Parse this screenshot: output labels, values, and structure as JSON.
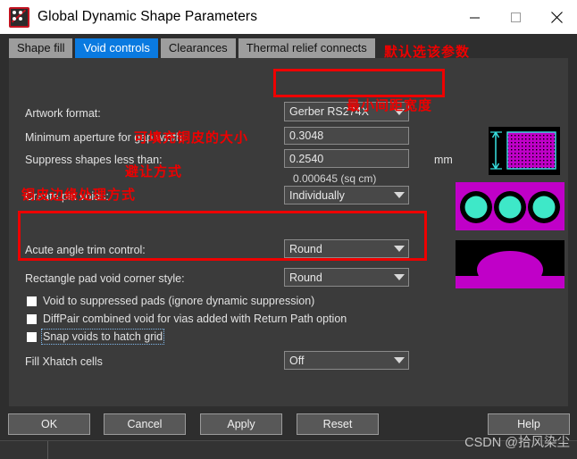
{
  "window": {
    "title": "Global Dynamic Shape Parameters",
    "icon": "allegro-app-icon",
    "minimize_label": "−",
    "maximize_label": "□",
    "close_label": "✕"
  },
  "tabs": [
    {
      "label": "Shape fill",
      "active": false
    },
    {
      "label": "Void controls",
      "active": true
    },
    {
      "label": "Clearances",
      "active": false
    },
    {
      "label": "Thermal relief connects",
      "active": false
    }
  ],
  "fields": {
    "artwork_format": {
      "label": "Artwork format:",
      "value": "Gerber RS274X"
    },
    "minimum_aperture": {
      "label": "Minimum aperture for gap width:",
      "value": "0.3048"
    },
    "suppress_shapes": {
      "label": "Suppress shapes less than:",
      "value": "0.2540",
      "unit": "mm",
      "area_note": "0.000645 (sq cm)"
    },
    "create_pin_voids": {
      "label": "Create pin voids:",
      "value": "Individually"
    },
    "acute_angle": {
      "label": "Acute angle trim control:",
      "value": "Round"
    },
    "rect_pad_corner": {
      "label": "Rectangle pad void corner style:",
      "value": "Round"
    },
    "fill_xhatch": {
      "label": "Fill Xhatch cells",
      "value": "Off"
    }
  },
  "checkboxes": [
    {
      "label": "Void to suppressed pads (ignore dynamic suppression)",
      "checked": false,
      "focused": false
    },
    {
      "label": "DiffPair combined void for vias added with Return Path option",
      "checked": false,
      "focused": false
    },
    {
      "label": "Snap voids to hatch grid",
      "checked": false,
      "focused": true
    }
  ],
  "buttons": {
    "ok": "OK",
    "cancel": "Cancel",
    "apply": "Apply",
    "reset": "Reset",
    "help": "Help"
  },
  "previews": [
    {
      "name": "gap-width-preview",
      "description": "cyan dimension arrow beside magenta hatched square on black"
    },
    {
      "name": "pin-voids-preview",
      "description": "three cyan pads with black voids on magenta copper"
    },
    {
      "name": "acute-angle-preview",
      "description": "magenta rounded dome shape on black"
    }
  ],
  "annotations": [
    {
      "id": "anno-default-param",
      "text": "默认选该参数"
    },
    {
      "id": "anno-min-gap-width",
      "text": "最小间距宽度"
    },
    {
      "id": "anno-copper-size",
      "text": "可填充铜皮的大小"
    },
    {
      "id": "anno-avoid-mode",
      "text": "避让方式"
    },
    {
      "id": "anno-copper-edge",
      "text": "铜皮边缘处理方式"
    }
  ],
  "watermark": "CSDN @拾风染尘",
  "colors": {
    "accent": "#0a7ae0",
    "annotation": "#ee0000",
    "copper": "#c000c8",
    "pad": "#3ee8c8",
    "panel": "#3b3b3b",
    "dialog": "#2e2e2e"
  }
}
